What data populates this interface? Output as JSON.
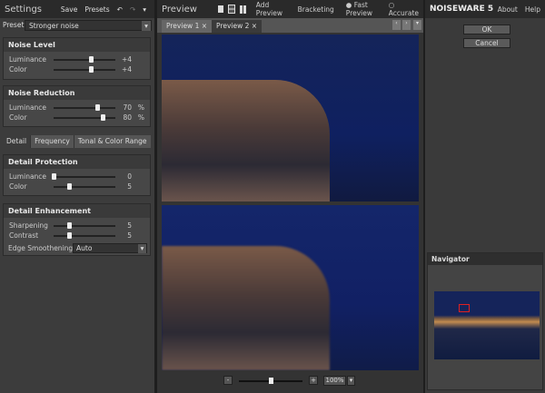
{
  "settings": {
    "title": "Settings",
    "save": "Save",
    "presets": "Presets",
    "preset_label": "Preset",
    "preset_value": "Stronger noise"
  },
  "noise_level": {
    "title": "Noise Level",
    "rows": [
      {
        "label": "Luminance",
        "value": "+4",
        "pos": 0.6
      },
      {
        "label": "Color",
        "value": "+4",
        "pos": 0.6
      }
    ]
  },
  "noise_reduction": {
    "title": "Noise Reduction",
    "rows": [
      {
        "label": "Luminance",
        "value": "70",
        "unit": "%",
        "pos": 0.7
      },
      {
        "label": "Color",
        "value": "80",
        "unit": "%",
        "pos": 0.8
      }
    ]
  },
  "tabs": [
    "Detail",
    "Frequency",
    "Tonal & Color Range"
  ],
  "detail_protection": {
    "title": "Detail Protection",
    "rows": [
      {
        "label": "Luminance",
        "value": "0",
        "pos": 0
      },
      {
        "label": "Color",
        "value": "5",
        "pos": 0.25
      }
    ]
  },
  "detail_enhancement": {
    "title": "Detail Enhancement",
    "rows": [
      {
        "label": "Sharpening",
        "value": "5",
        "pos": 0.25
      },
      {
        "label": "Contrast",
        "value": "5",
        "pos": 0.25
      }
    ],
    "edge_label": "Edge Smoothening",
    "edge_value": "Auto"
  },
  "preview": {
    "title": "Preview",
    "add_preview": "Add Preview",
    "bracketing": "Bracketing",
    "fast_preview": "Fast Preview",
    "accurate": "Accurate",
    "tabs": [
      "Preview 1",
      "Preview 2"
    ],
    "active_tab": 1,
    "zoom": "100%",
    "zoom_pos": 0.5
  },
  "app": {
    "logo": "NOISEWARE 5",
    "about": "About",
    "help": "Help",
    "ok": "OK",
    "cancel": "Cancel"
  },
  "navigator": {
    "title": "Navigator"
  }
}
